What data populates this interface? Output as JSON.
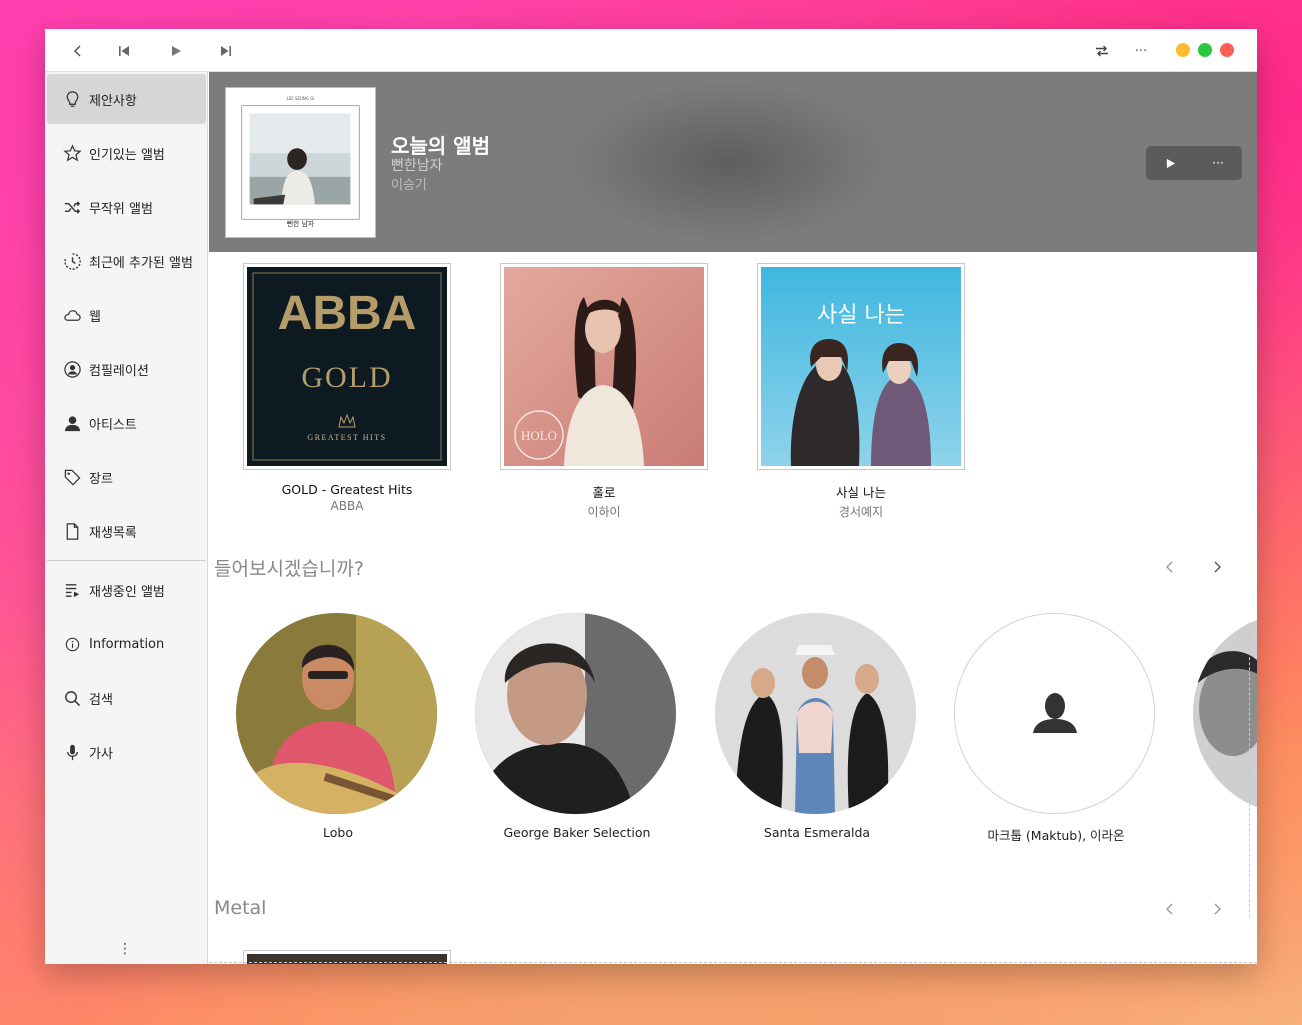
{
  "titlebar": {
    "back_icon": "chevron-left-icon",
    "prev_icon": "skip-previous-icon",
    "play_icon": "play-icon",
    "next_icon": "skip-next-icon",
    "repeat_icon": "repeat-icon",
    "more_label": "···",
    "lights": {
      "yellow": "#fdbc2e",
      "green": "#28c840",
      "red": "#ff5f57"
    }
  },
  "sidebar": {
    "items": [
      {
        "label": "제안사항",
        "icon": "lightbulb-icon"
      },
      {
        "label": "인기있는 앨범",
        "icon": "star-icon"
      },
      {
        "label": "무작위 앨범",
        "icon": "shuffle-icon"
      },
      {
        "label": "최근에 추가된 앨범",
        "icon": "recent-icon"
      },
      {
        "label": "웹",
        "icon": "cloud-icon"
      },
      {
        "label": "컴필레이션",
        "icon": "person-circle-icon"
      },
      {
        "label": "아티스트",
        "icon": "person-icon"
      },
      {
        "label": "장르",
        "icon": "tag-icon"
      },
      {
        "label": "재생목록",
        "icon": "document-icon"
      },
      {
        "label": "재생중인 앨범",
        "icon": "playlist-play-icon"
      },
      {
        "label": "Information",
        "icon": "info-icon"
      },
      {
        "label": "검색",
        "icon": "search-icon"
      },
      {
        "label": "가사",
        "icon": "microphone-icon"
      }
    ],
    "more_label": "⋮"
  },
  "banner": {
    "title": "오늘의 앨범",
    "album": "뻔한남자",
    "artist": "이승기",
    "cover_text": "뻔한 남자",
    "play_icon": "play-icon",
    "more_label": "···"
  },
  "albums": [
    {
      "title": "GOLD - Greatest Hits",
      "artist": "ABBA",
      "cover_line1": "ABBA",
      "cover_line2": "GOLD",
      "cover_line3": "GREATEST HITS"
    },
    {
      "title": "홀로",
      "artist": "이하이",
      "cover_text": "HOLO"
    },
    {
      "title": "사실 나는",
      "artist": "경서예지",
      "cover_text": "사실 나는"
    }
  ],
  "sections": {
    "suggest_title": "들어보시겠습니까?",
    "metal_title": "Metal"
  },
  "artists": [
    {
      "name": "Lobo"
    },
    {
      "name": "George Baker Selection"
    },
    {
      "name": "Santa Esmeralda"
    },
    {
      "name": "마크툽 (Maktub), 이라온"
    }
  ],
  "colors": {
    "accent_banner": "#7c7c7c",
    "sidebar_active": "#d6d6d6"
  }
}
